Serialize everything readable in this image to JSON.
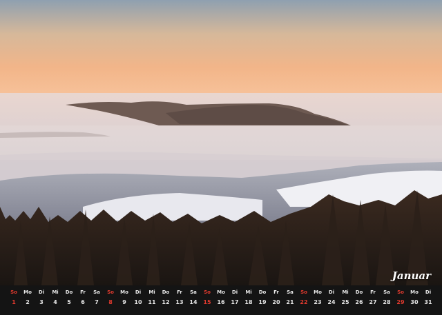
{
  "calendar": {
    "month": "Januar",
    "sunday_color": "#e23a2e",
    "text_color": "#e8e8e8",
    "days": [
      {
        "weekday": "So",
        "day": "1",
        "sunday": true
      },
      {
        "weekday": "Mo",
        "day": "2"
      },
      {
        "weekday": "Di",
        "day": "3"
      },
      {
        "weekday": "Mi",
        "day": "4"
      },
      {
        "weekday": "Do",
        "day": "5"
      },
      {
        "weekday": "Fr",
        "day": "6"
      },
      {
        "weekday": "Sa",
        "day": "7"
      },
      {
        "weekday": "So",
        "day": "8",
        "sunday": true
      },
      {
        "weekday": "Mo",
        "day": "9"
      },
      {
        "weekday": "Di",
        "day": "10"
      },
      {
        "weekday": "Mi",
        "day": "11"
      },
      {
        "weekday": "Do",
        "day": "12"
      },
      {
        "weekday": "Fr",
        "day": "13"
      },
      {
        "weekday": "Sa",
        "day": "14"
      },
      {
        "weekday": "So",
        "day": "15",
        "sunday": true
      },
      {
        "weekday": "Mo",
        "day": "16"
      },
      {
        "weekday": "Di",
        "day": "17"
      },
      {
        "weekday": "Mi",
        "day": "18"
      },
      {
        "weekday": "Do",
        "day": "19"
      },
      {
        "weekday": "Fr",
        "day": "20"
      },
      {
        "weekday": "Sa",
        "day": "21"
      },
      {
        "weekday": "So",
        "day": "22",
        "sunday": true
      },
      {
        "weekday": "Mo",
        "day": "23"
      },
      {
        "weekday": "Di",
        "day": "24"
      },
      {
        "weekday": "Mi",
        "day": "25"
      },
      {
        "weekday": "Do",
        "day": "26"
      },
      {
        "weekday": "Fr",
        "day": "27"
      },
      {
        "weekday": "Sa",
        "day": "28"
      },
      {
        "weekday": "So",
        "day": "29",
        "sunday": true
      },
      {
        "weekday": "Mo",
        "day": "30"
      },
      {
        "weekday": "Di",
        "day": "31"
      }
    ]
  }
}
